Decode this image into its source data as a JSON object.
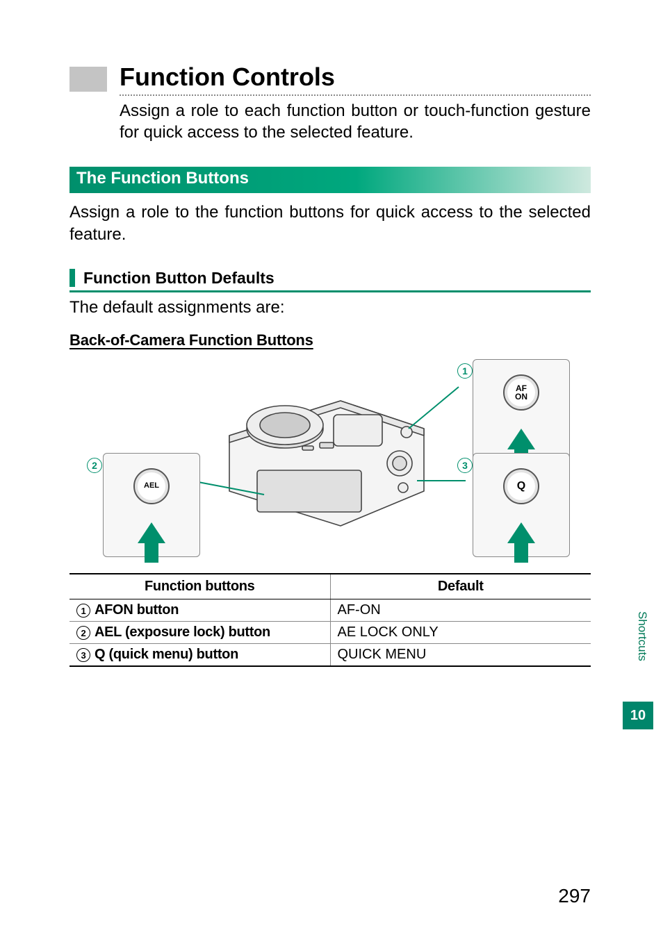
{
  "title": "Function Controls",
  "intro": "Assign a role to each function button or touch-function gesture for quick access to the selected feature.",
  "subhead": "The Function Buttons",
  "subbody": "Assign a role to the function buttons for quick access to the selected feature.",
  "defaults_head": "Function Button Defaults",
  "defaults_body": "The default assignments are:",
  "back_head": "Back-of-Camera Function Buttons",
  "callouts": {
    "c1": {
      "num": "1",
      "label": "AF\nON"
    },
    "c2": {
      "num": "2",
      "label": "AEL"
    },
    "c3": {
      "num": "3",
      "label": "Q"
    }
  },
  "table": {
    "head1": "Function buttons",
    "head2": "Default",
    "rows": [
      {
        "num": "1",
        "name": "AFON button",
        "def": "AF-ON"
      },
      {
        "num": "2",
        "name": "AEL (exposure lock) button",
        "def": "AE LOCK ONLY"
      },
      {
        "num": "3",
        "name": "Q (quick menu) button",
        "def": "QUICK MENU"
      }
    ]
  },
  "side": {
    "label": "Shortcuts",
    "chapter": "10"
  },
  "page_number": "297"
}
